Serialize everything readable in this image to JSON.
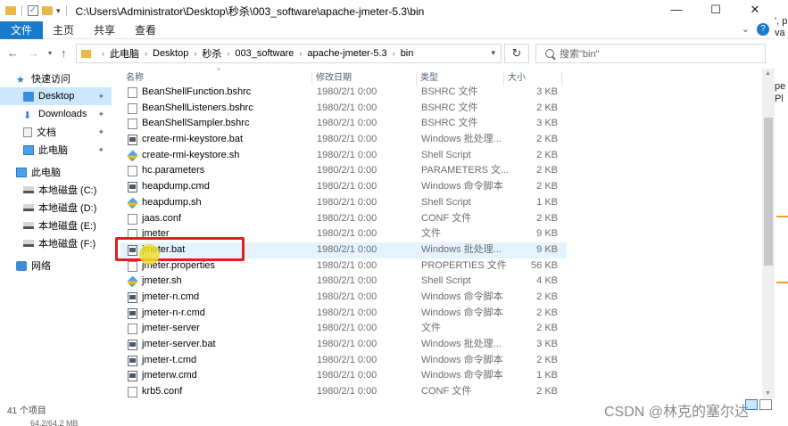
{
  "window": {
    "title": "C:\\Users\\Administrator\\Desktop\\秒杀\\003_software\\apache-jmeter-5.3\\bin",
    "controls": {
      "minimize": "—",
      "maximize": "☐",
      "close": "✕"
    }
  },
  "ribbon": {
    "tabs": [
      "文件",
      "主页",
      "共享",
      "查看"
    ],
    "expand_glyph": "⌄",
    "help_glyph": "?"
  },
  "address": {
    "breadcrumbs": [
      "此电脑",
      "Desktop",
      "秒杀",
      "003_software",
      "apache-jmeter-5.3",
      "bin"
    ],
    "search_placeholder": "搜索\"bin\""
  },
  "sidebar": {
    "items": [
      {
        "label": "快速访问",
        "icon": "star-icon",
        "pinned": false,
        "selected": false,
        "indent": 1
      },
      {
        "label": "Desktop",
        "icon": "desktop-icon",
        "pinned": true,
        "selected": true,
        "indent": 2
      },
      {
        "label": "Downloads",
        "icon": "download-icon",
        "pinned": true,
        "selected": false,
        "indent": 2
      },
      {
        "label": "文档",
        "icon": "document-icon",
        "pinned": true,
        "selected": false,
        "indent": 2
      },
      {
        "label": "此电脑",
        "icon": "computer-icon",
        "pinned": true,
        "selected": false,
        "indent": 2
      },
      {
        "label": "此电脑",
        "icon": "computer-icon",
        "pinned": false,
        "selected": false,
        "indent": 1
      },
      {
        "label": "本地磁盘 (C:)",
        "icon": "drive-icon",
        "pinned": false,
        "selected": false,
        "indent": 2
      },
      {
        "label": "本地磁盘 (D:)",
        "icon": "drive-icon",
        "pinned": false,
        "selected": false,
        "indent": 2
      },
      {
        "label": "本地磁盘 (E:)",
        "icon": "drive-icon",
        "pinned": false,
        "selected": false,
        "indent": 2
      },
      {
        "label": "本地磁盘 (F:)",
        "icon": "drive-icon",
        "pinned": false,
        "selected": false,
        "indent": 2
      },
      {
        "label": "网络",
        "icon": "network-icon",
        "pinned": false,
        "selected": false,
        "indent": 1
      }
    ]
  },
  "columns": {
    "name": "名称",
    "date": "修改日期",
    "type": "类型",
    "size": "大小"
  },
  "files": [
    {
      "name": "BeanShellFunction.bshrc",
      "date": "1980/2/1 0:00",
      "type": "BSHRC 文件",
      "size": "3 KB",
      "icon": "file-icon"
    },
    {
      "name": "BeanShellListeners.bshrc",
      "date": "1980/2/1 0:00",
      "type": "BSHRC 文件",
      "size": "2 KB",
      "icon": "file-icon"
    },
    {
      "name": "BeanShellSampler.bshrc",
      "date": "1980/2/1 0:00",
      "type": "BSHRC 文件",
      "size": "3 KB",
      "icon": "file-icon"
    },
    {
      "name": "create-rmi-keystore.bat",
      "date": "1980/2/1 0:00",
      "type": "Windows 批处理...",
      "size": "2 KB",
      "icon": "batch-file-icon"
    },
    {
      "name": "create-rmi-keystore.sh",
      "date": "1980/2/1 0:00",
      "type": "Shell Script",
      "size": "2 KB",
      "icon": "shell-script-icon"
    },
    {
      "name": "hc.parameters",
      "date": "1980/2/1 0:00",
      "type": "PARAMETERS 文...",
      "size": "2 KB",
      "icon": "file-icon"
    },
    {
      "name": "heapdump.cmd",
      "date": "1980/2/1 0:00",
      "type": "Windows 命令脚本",
      "size": "2 KB",
      "icon": "batch-file-icon"
    },
    {
      "name": "heapdump.sh",
      "date": "1980/2/1 0:00",
      "type": "Shell Script",
      "size": "1 KB",
      "icon": "shell-script-icon"
    },
    {
      "name": "jaas.conf",
      "date": "1980/2/1 0:00",
      "type": "CONF 文件",
      "size": "2 KB",
      "icon": "file-icon"
    },
    {
      "name": "jmeter",
      "date": "1980/2/1 0:00",
      "type": "文件",
      "size": "9 KB",
      "icon": "file-icon"
    },
    {
      "name": "jmeter.bat",
      "date": "1980/2/1 0:00",
      "type": "Windows 批处理...",
      "size": "9 KB",
      "icon": "batch-file-icon",
      "highlighted": true
    },
    {
      "name": "jmeter.properties",
      "date": "1980/2/1 0:00",
      "type": "PROPERTIES 文件",
      "size": "56 KB",
      "icon": "file-icon"
    },
    {
      "name": "jmeter.sh",
      "date": "1980/2/1 0:00",
      "type": "Shell Script",
      "size": "4 KB",
      "icon": "shell-script-icon"
    },
    {
      "name": "jmeter-n.cmd",
      "date": "1980/2/1 0:00",
      "type": "Windows 命令脚本",
      "size": "2 KB",
      "icon": "batch-file-icon"
    },
    {
      "name": "jmeter-n-r.cmd",
      "date": "1980/2/1 0:00",
      "type": "Windows 命令脚本",
      "size": "2 KB",
      "icon": "batch-file-icon"
    },
    {
      "name": "jmeter-server",
      "date": "1980/2/1 0:00",
      "type": "文件",
      "size": "2 KB",
      "icon": "file-icon"
    },
    {
      "name": "jmeter-server.bat",
      "date": "1980/2/1 0:00",
      "type": "Windows 批处理...",
      "size": "3 KB",
      "icon": "batch-file-icon"
    },
    {
      "name": "jmeter-t.cmd",
      "date": "1980/2/1 0:00",
      "type": "Windows 命令脚本",
      "size": "2 KB",
      "icon": "batch-file-icon"
    },
    {
      "name": "jmeterw.cmd",
      "date": "1980/2/1 0:00",
      "type": "Windows 命令脚本",
      "size": "1 KB",
      "icon": "batch-file-icon"
    },
    {
      "name": "krb5.conf",
      "date": "1980/2/1 0:00",
      "type": "CONF 文件",
      "size": "2 KB",
      "icon": "file-icon"
    }
  ],
  "status": {
    "item_count": "41 个项目",
    "selection_size": "64.2/64.2 MB"
  },
  "overlay_strip": {
    "lines": [
      "', por",
      "pe",
      "Pl",
      "va"
    ]
  },
  "watermark": "CSDN @林克的塞尔达",
  "colors": {
    "accent": "#1979ca",
    "selection": "#cce8ff",
    "hover": "#e5f3ff",
    "annotation_red": "#e02020",
    "cursor_yellow": "#f0dc28"
  }
}
